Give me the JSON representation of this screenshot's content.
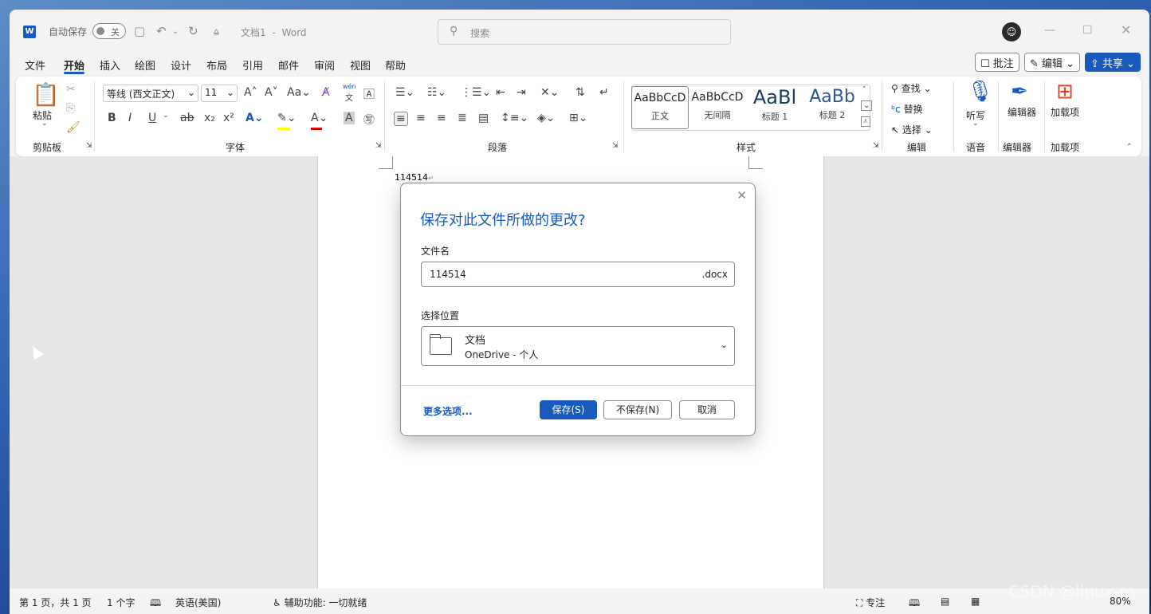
{
  "titlebar": {
    "autosave_label": "自动保存",
    "autosave_state": "关",
    "doc_title": "文档1",
    "app_name": "Word",
    "separator": "-",
    "search_placeholder": "搜索"
  },
  "menu": {
    "items": [
      "文件",
      "开始",
      "插入",
      "绘图",
      "设计",
      "布局",
      "引用",
      "邮件",
      "审阅",
      "视图",
      "帮助"
    ],
    "active": "开始",
    "comments": "批注",
    "editing": "编辑",
    "share": "共享"
  },
  "ribbon": {
    "clipboard": {
      "paste": "粘贴",
      "label": "剪贴板"
    },
    "font": {
      "name": "等线 (西文正文)",
      "size": "11",
      "label": "字体",
      "aa": "Aa",
      "wen": "wén"
    },
    "paragraph": {
      "label": "段落"
    },
    "styles": {
      "label": "样式",
      "cards": [
        {
          "sample": "AaBbCcD",
          "name": "正文"
        },
        {
          "sample": "AaBbCcD",
          "name": "无间隔"
        },
        {
          "sample": "AaBl",
          "name": "标题 1"
        },
        {
          "sample": "AaBb",
          "name": "标题 2"
        }
      ]
    },
    "editing": {
      "find": "查找",
      "replace": "替换",
      "select": "选择",
      "label": "编辑"
    },
    "voice": {
      "dictate": "听写",
      "label": "语音"
    },
    "editor": {
      "button": "编辑器",
      "label": "编辑器"
    },
    "addins": {
      "button": "加载项",
      "label": "加载项"
    }
  },
  "document": {
    "text": "114514"
  },
  "dialog": {
    "title": "保存对此文件所做的更改?",
    "filename_label": "文件名",
    "filename_value": "114514",
    "extension": ".docx",
    "location_label": "选择位置",
    "location_name": "文档",
    "location_sub": "OneDrive - 个人",
    "more_options": "更多选项...",
    "save": "保存(S)",
    "dont_save": "不保存(N)",
    "cancel": "取消"
  },
  "statusbar": {
    "page": "第 1 页，共 1 页",
    "words": "1 个字",
    "language": "英语(美国)",
    "accessibility": "辅助功能: 一切就绪",
    "focus": "专注",
    "zoom": "80%"
  },
  "watermark": "CSDN @linux-m",
  "colors": {
    "accent": "#185abd",
    "ribbon_bg": "#ffffff",
    "chrome_bg": "#f3f3f3"
  }
}
